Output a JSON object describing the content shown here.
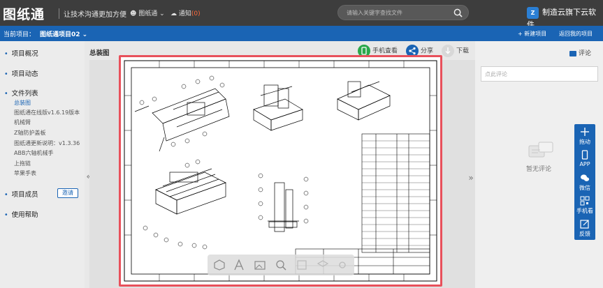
{
  "topbar": {
    "logo": "图纸通",
    "slogan": "让技术沟通更加方便",
    "user_menu": "图纸通",
    "notice_label": "通知",
    "notice_count": "(0)",
    "search_placeholder": "请输入关键字查找文件",
    "brand": "制造云旗下云软件",
    "brand_badge": "Z"
  },
  "projbar": {
    "current_label": "当前项目：",
    "project_name": "图纸通项目02",
    "new_project": "+ 新建项目",
    "back_project": "返回我的项目"
  },
  "sidebar": {
    "overview": "项目概况",
    "activity": "项目动态",
    "files": "文件列表",
    "file_items": [
      "总装图",
      "图纸通在线版v1.6.19版本",
      "机械臂",
      "Z轴防护盖板",
      "图纸通更新说明：v1.3.36",
      "ABB六轴机械手",
      "上拖链",
      "苹果手表"
    ],
    "members": "项目成员",
    "invite": "邀请",
    "help": "使用帮助",
    "collapse": "«"
  },
  "main": {
    "title": "总装图",
    "actions": [
      "手机查看",
      "分享",
      "下载"
    ],
    "expand": "»"
  },
  "comments": {
    "title": "评论",
    "placeholder": "点此评论",
    "empty": "暂无评论"
  },
  "floatbar": {
    "items": [
      "拖动",
      "APP",
      "微信",
      "手机看",
      "反馈"
    ]
  },
  "colors": {
    "topbar": "#3d3d3d",
    "accent": "#1a64b4",
    "frame": "#e8505b",
    "green": "#2aa84a"
  }
}
